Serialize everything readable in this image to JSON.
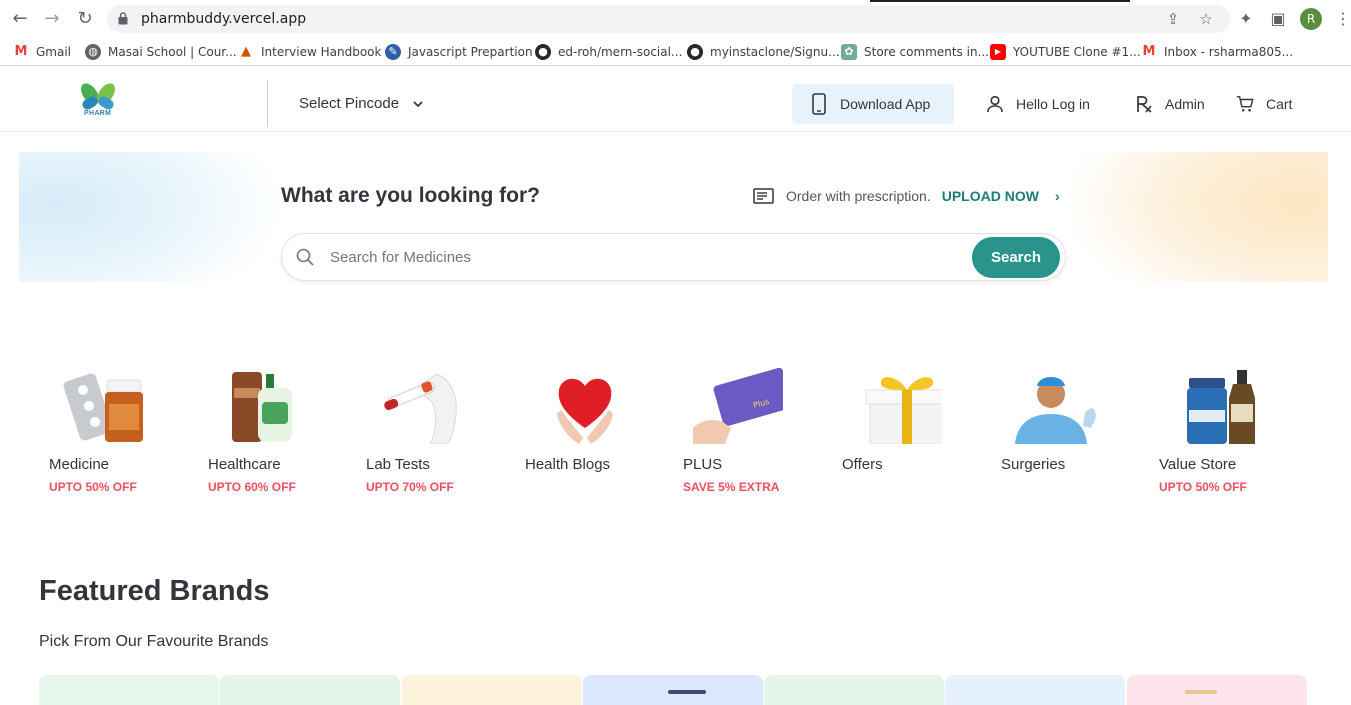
{
  "browser": {
    "url": "pharmbuddy.vercel.app",
    "avatar_letter": "R",
    "bookmarks": [
      {
        "label": "Gmail",
        "icon": "gmail-icon",
        "color": "#ea4335"
      },
      {
        "label": "Masai School | Cour...",
        "icon": "globe-icon",
        "color": "#5f6368"
      },
      {
        "label": "Interview Handbook",
        "icon": "tower-icon",
        "color": "#d35400"
      },
      {
        "label": "Javascript Prepartion",
        "icon": "blue-logo-icon",
        "color": "#2e5fa8"
      },
      {
        "label": "ed-roh/mern-social...",
        "icon": "github-icon",
        "color": "#24292e"
      },
      {
        "label": "myinstaclone/Signu...",
        "icon": "github-icon",
        "color": "#24292e"
      },
      {
        "label": "Store comments in...",
        "icon": "chatgpt-icon",
        "color": "#74aa9c"
      },
      {
        "label": "YOUTUBE Clone #1...",
        "icon": "youtube-icon",
        "color": "#ff0000"
      },
      {
        "label": "Inbox - rsharma805...",
        "icon": "gmail-icon",
        "color": "#ea4335"
      }
    ]
  },
  "header": {
    "logo_text": "PHARM",
    "pincode_label": "Select Pincode",
    "download_label": "Download App",
    "login_label": "Hello Log in",
    "admin_label": "Admin",
    "cart_label": "Cart"
  },
  "search": {
    "title": "What are you looking for?",
    "prescription_text": "Order with prescription.",
    "upload_label": "UPLOAD NOW",
    "placeholder": "Search for Medicines",
    "button_label": "Search"
  },
  "categories": [
    {
      "name": "Medicine",
      "offer": "UPTO 50% OFF",
      "icon": "pills-bottle-icon"
    },
    {
      "name": "Healthcare",
      "offer": "UPTO 60% OFF",
      "icon": "handwash-icon"
    },
    {
      "name": "Lab Tests",
      "offer": "UPTO 70% OFF",
      "icon": "test-tube-icon"
    },
    {
      "name": "Health Blogs",
      "offer": "",
      "icon": "heart-hands-icon"
    },
    {
      "name": "PLUS",
      "offer": "SAVE 5% EXTRA",
      "icon": "plus-card-icon"
    },
    {
      "name": "Offers",
      "offer": "",
      "icon": "gift-box-icon"
    },
    {
      "name": "Surgeries",
      "offer": "",
      "icon": "surgeon-icon"
    },
    {
      "name": "Value Store",
      "offer": "UPTO 50% OFF",
      "icon": "supplement-bottles-icon"
    }
  ],
  "featured": {
    "title": "Featured Brands",
    "subtitle": "Pick From Our Favourite Brands",
    "card_colors": [
      "#e6f8ec",
      "#e4f5ea",
      "#fdf3dc",
      "#dbe8fb",
      "#e4f5ea",
      "#e5f1fc",
      "#fde4ea"
    ]
  },
  "colors": {
    "accent": "#2a938b",
    "offer_red": "#ef4f5f",
    "upload_teal": "#1a7d76"
  }
}
